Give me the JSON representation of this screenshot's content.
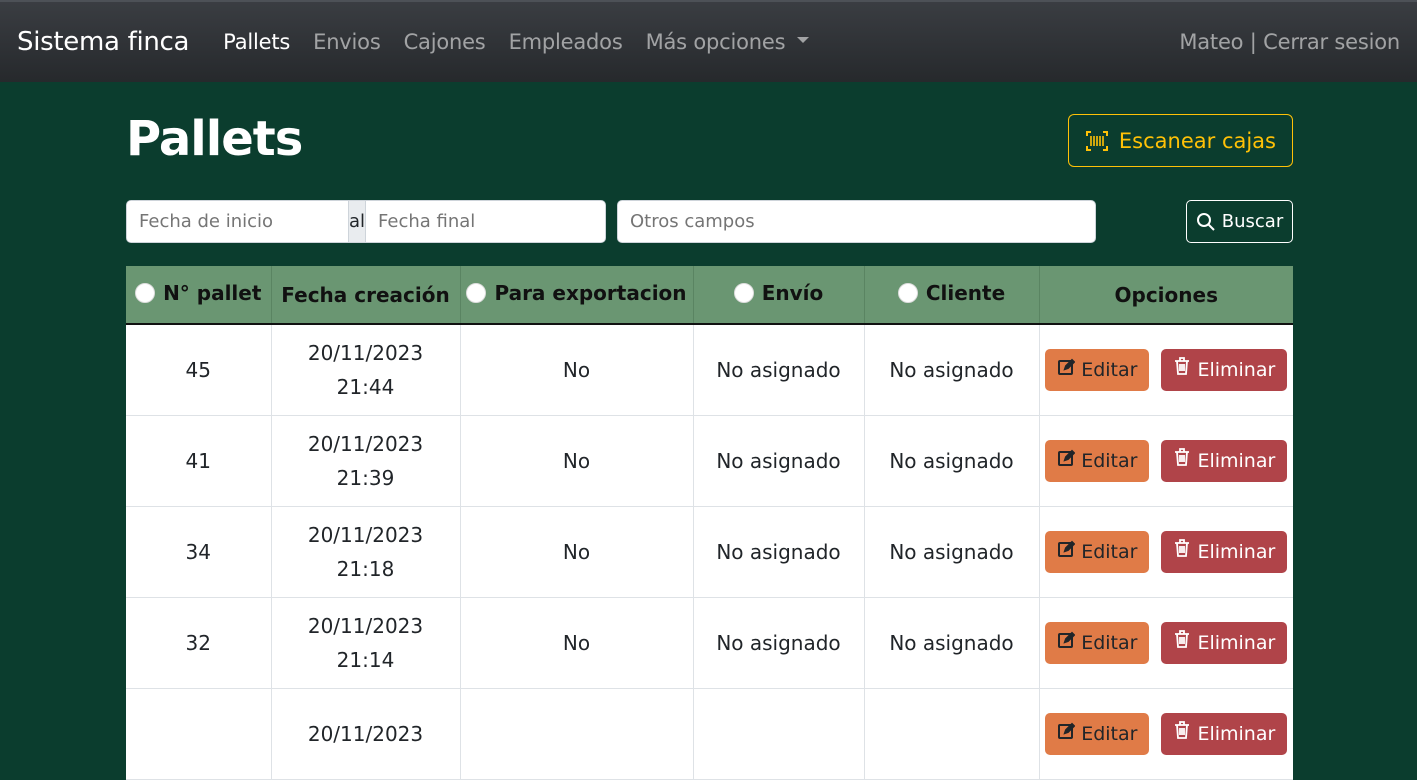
{
  "navbar": {
    "brand": "Sistema finca",
    "links": [
      "Pallets",
      "Envios",
      "Cajones",
      "Empleados",
      "Más opciones"
    ],
    "user": "Mateo | Cerrar sesion"
  },
  "page": {
    "title": "Pallets",
    "scan_label": "Escanear cajas"
  },
  "search": {
    "start_placeholder": "Fecha de inicio",
    "separator": "al",
    "end_placeholder": "Fecha final",
    "other_placeholder": "Otros campos",
    "button": "Buscar"
  },
  "table": {
    "headers": [
      "N° pallet",
      "Fecha creación",
      "Para exportacion",
      "Envío",
      "Cliente",
      "Opciones"
    ],
    "edit_label": "Editar",
    "delete_label": "Eliminar",
    "rows": [
      {
        "id": "45",
        "date": "20/11/2023",
        "time": "21:44",
        "export": "No",
        "envio": "No asignado",
        "cliente": "No asignado"
      },
      {
        "id": "41",
        "date": "20/11/2023",
        "time": "21:39",
        "export": "No",
        "envio": "No asignado",
        "cliente": "No asignado"
      },
      {
        "id": "34",
        "date": "20/11/2023",
        "time": "21:18",
        "export": "No",
        "envio": "No asignado",
        "cliente": "No asignado"
      },
      {
        "id": "32",
        "date": "20/11/2023",
        "time": "21:14",
        "export": "No",
        "envio": "No asignado",
        "cliente": "No asignado"
      },
      {
        "id": "",
        "date": "20/11/2023",
        "time": "",
        "export": "",
        "envio": "",
        "cliente": ""
      }
    ]
  },
  "colors": {
    "background": "#0b3d2e",
    "header": "#6a9672",
    "scan_accent": "#ffc107",
    "edit": "#e07b47",
    "delete": "#b04449"
  }
}
